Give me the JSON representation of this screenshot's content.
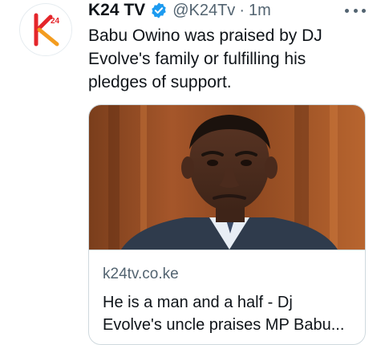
{
  "tweet": {
    "author_name": "K24 TV",
    "handle": "@K24Tv",
    "separator": "·",
    "time": "1m",
    "text": "Babu Owino was praised by DJ Evolve's family or fulfilling his pledges of support.",
    "avatar_logo_text": "24",
    "more_icon": "more-horizontal-icon",
    "verified_icon": "verified-badge-icon"
  },
  "card": {
    "domain": "k24tv.co.ke",
    "title_line1": "He is a man and a half - Dj",
    "title_line2": "Evolve's uncle praises MP Babu..."
  },
  "colors": {
    "text_primary": "#0f1419",
    "text_secondary": "#536471",
    "verified_blue": "#1d9bf0",
    "brand_red": "#e4262b",
    "brand_orange": "#f39c1f",
    "border": "#cfd9de"
  }
}
